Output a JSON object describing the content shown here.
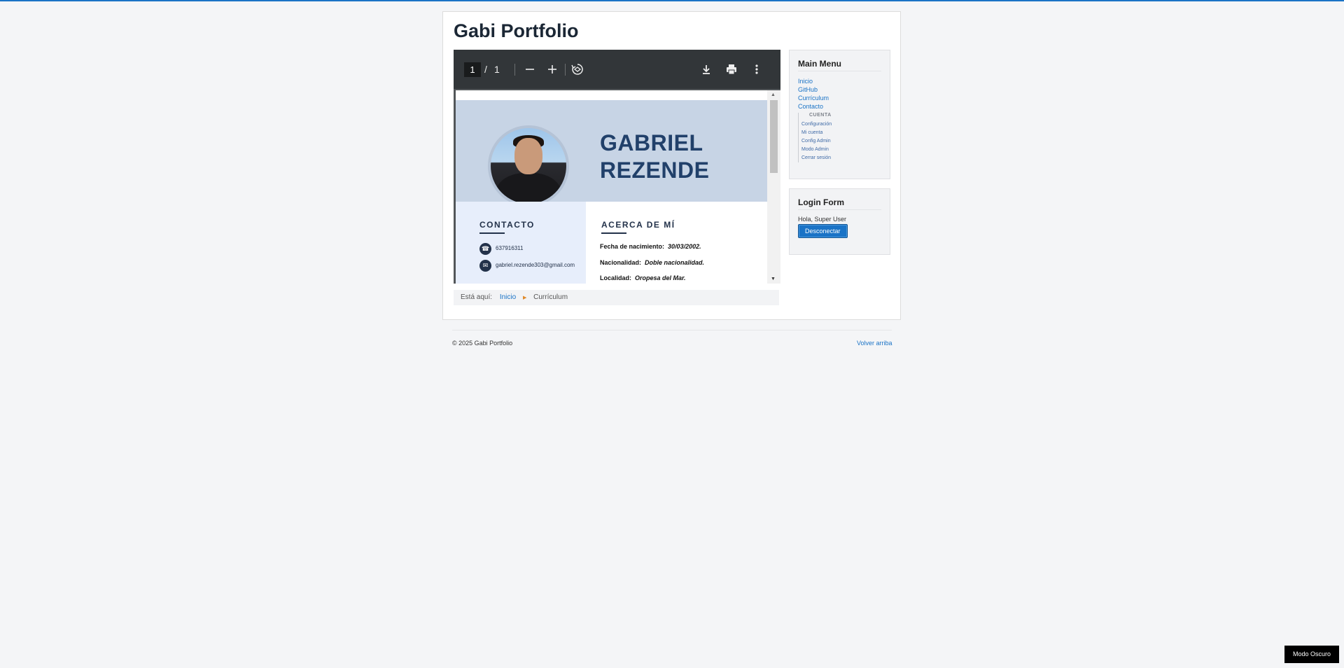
{
  "site": {
    "title": "Gabi Portfolio"
  },
  "pdf": {
    "current_page": "1",
    "separator": "/",
    "total_pages": "1",
    "icons": {
      "zoom_out": "minus-icon",
      "zoom_in": "plus-icon",
      "rotate": "rotate-icon",
      "download": "download-icon",
      "print": "print-icon",
      "more": "more-vertical-icon"
    },
    "cv": {
      "first_name": "GABRIEL",
      "last_name": "REZENDE",
      "contact_heading": "CONTACTO",
      "phone": "637916311",
      "email": "gabriel.rezende303@gmail.com",
      "about_heading": "ACERCA DE MÍ",
      "fields": [
        {
          "label": "Fecha de nacimiento:",
          "value": "30/03/2002."
        },
        {
          "label": "Nacionalidad:",
          "value": "Doble nacionalidad."
        },
        {
          "label": "Localidad:",
          "value": "Oropesa del Mar."
        }
      ]
    }
  },
  "breadcrumb": {
    "prefix": "Está aquí:",
    "home": "Inicio",
    "separator": "▶",
    "current": "Currículum"
  },
  "main_menu": {
    "title": "Main Menu",
    "items": [
      "Inicio",
      "GitHub",
      "Currículum",
      "Contacto"
    ],
    "account_label": "CUENTA",
    "account_items": [
      "Configuración",
      "Mi cuenta",
      "Config Admin",
      "Modo Admin",
      "Cerrar sesión"
    ]
  },
  "login": {
    "title": "Login Form",
    "greeting": "Hola, Super User",
    "logout_label": "Desconectar"
  },
  "footer": {
    "copyright": "© 2025 Gabi Portfolio",
    "back_to_top": "Volver arriba"
  },
  "dark_mode_label": "Modo Oscuro",
  "colors": {
    "accent": "#1a73c6",
    "cv_navy": "#21406a",
    "pdf_toolbar": "#323639"
  }
}
